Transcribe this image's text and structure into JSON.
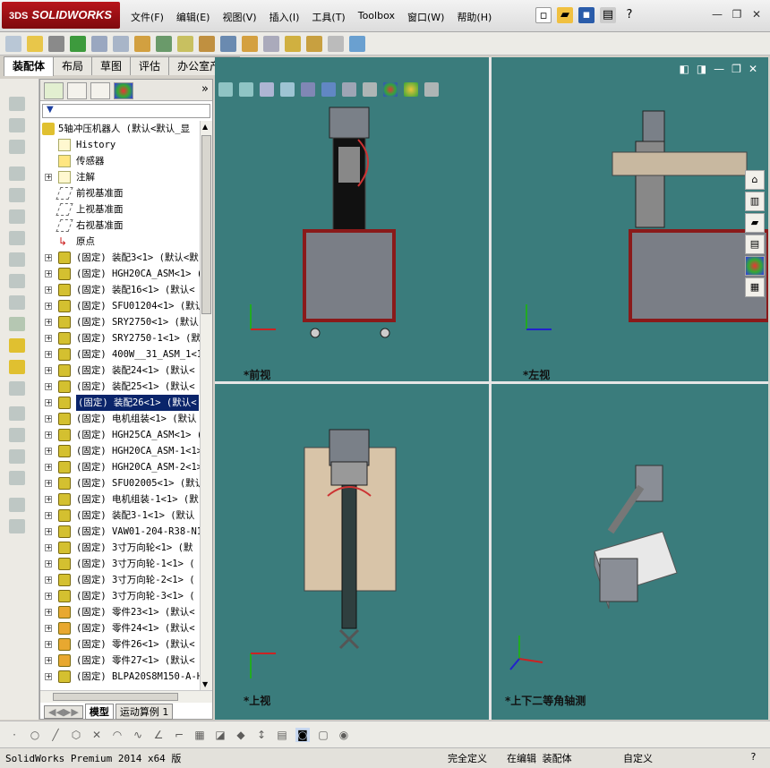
{
  "app": {
    "logo_prefix": "3DS",
    "logo_text": "SOLIDWORKS"
  },
  "menu": [
    "文件(F)",
    "编辑(E)",
    "视图(V)",
    "插入(I)",
    "工具(T)",
    "Toolbox",
    "窗口(W)",
    "帮助(H)"
  ],
  "tabs": [
    "装配体",
    "布局",
    "草图",
    "评估",
    "办公室产品"
  ],
  "tree": {
    "root": "5轴冲压机器人  (默认<默认_显",
    "history": "History",
    "sensors": "传感器",
    "annotations": "注解",
    "front_plane": "前视基准面",
    "top_plane": "上视基准面",
    "right_plane": "右视基准面",
    "origin": "原点",
    "items": [
      "(固定) 装配3<1> (默认<默",
      "(固定) HGH20CA_ASM<1> (",
      "(固定) 装配16<1> (默认<",
      "(固定) SFU01204<1> (默认",
      "(固定) SRY2750<1> (默认",
      "(固定) SRY2750-1<1> (默",
      "(固定) 400W__31_ASM_1<1",
      "(固定) 装配24<1> (默认<",
      "(固定) 装配25<1> (默认<",
      "(固定) 装配26<1> (默认<",
      "(固定) 电机组装<1> (默认",
      "(固定) HGH25CA_ASM<1> (",
      "(固定) HGH20CA_ASM-1<1>",
      "(固定) HGH20CA_ASM-2<1>",
      "(固定) SFU02005<1> (默认",
      "(固定) 电机组装-1<1> (默",
      "(固定) 装配3-1<1> (默认",
      "(固定) VAW01-204-R38-N1",
      "(固定) 3寸万向轮<1> (默",
      "(固定) 3寸万向轮-1<1> (",
      "(固定) 3寸万向轮-2<1> (",
      "(固定) 3寸万向轮-3<1> (",
      "(固定) 零件23<1> (默认<",
      "(固定) 零件24<1> (默认<",
      "(固定) 零件26<1> (默认<",
      "(固定) 零件27<1> (默认<",
      "(固定) BLPA20S8M150-A-H"
    ],
    "selected_index": 9
  },
  "panel_bottom_tabs": [
    "模型",
    "运动算例 1"
  ],
  "views": {
    "front": "*前视",
    "left": "*左视",
    "top": "*上视",
    "iso": "*上下二等角轴测"
  },
  "footer": {
    "product": "SolidWorks Premium 2014 x64 版",
    "state": "完全定义",
    "editing": "在编辑 装配体",
    "custom": "自定义"
  },
  "colors": {
    "viewport": "#3a7c7c",
    "selection": "#0a246a",
    "brand": "#b8151b"
  }
}
